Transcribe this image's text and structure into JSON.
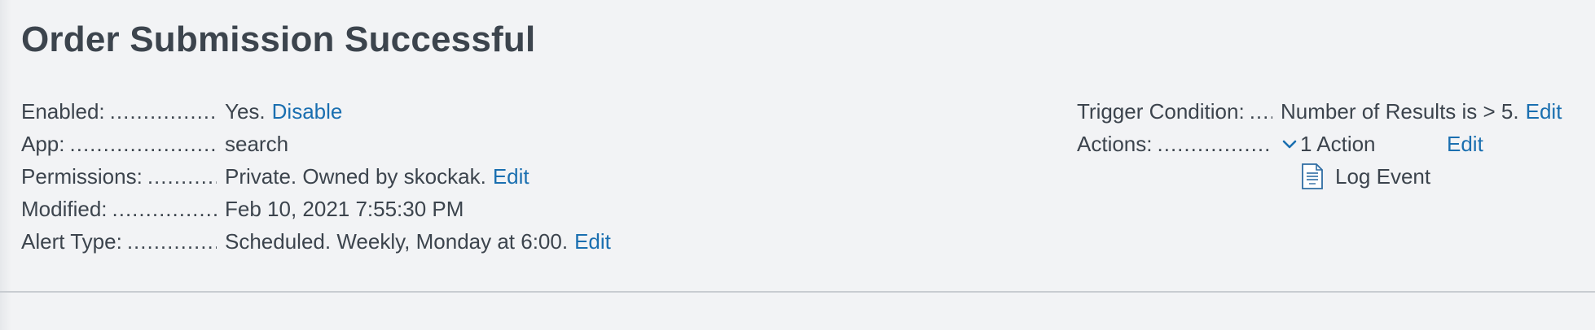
{
  "title": "Order Submission Successful",
  "left_details": {
    "enabled": {
      "label": "Enabled:",
      "value": "Yes.",
      "link": "Disable"
    },
    "app": {
      "label": "App:",
      "value": "search"
    },
    "permissions": {
      "label": "Permissions:",
      "value": "Private. Owned by skockak.",
      "link": "Edit"
    },
    "modified": {
      "label": "Modified:",
      "value": "Feb 10, 2021 7:55:30 PM"
    },
    "alert_type": {
      "label": "Alert Type:",
      "value": "Scheduled. Weekly, Monday at 6:00.",
      "link": "Edit"
    }
  },
  "right_details": {
    "trigger": {
      "label": "Trigger Condition:",
      "value": "Number of Results is > 5.",
      "link": "Edit"
    },
    "actions": {
      "label": "Actions:",
      "value": "1 Action",
      "link": "Edit",
      "icon": "chevron-down-icon"
    },
    "action_items": [
      {
        "label": "Log Event",
        "icon": "log-document-icon"
      }
    ]
  },
  "colors": {
    "background": "#f2f3f5",
    "text": "#3c444d",
    "link": "#1a6fb0",
    "divider": "#c8ccd1"
  }
}
